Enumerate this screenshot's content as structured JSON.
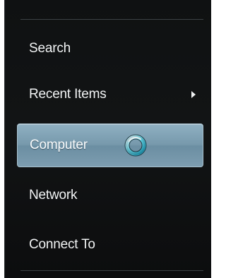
{
  "menu": {
    "items": [
      {
        "label": "Search",
        "has_submenu": false,
        "selected": false
      },
      {
        "label": "Recent Items",
        "has_submenu": true,
        "selected": false
      },
      {
        "label": "Computer",
        "has_submenu": false,
        "selected": true
      },
      {
        "label": "Network",
        "has_submenu": false,
        "selected": false
      },
      {
        "label": "Connect To",
        "has_submenu": false,
        "selected": false
      }
    ]
  },
  "cursor": {
    "icon": "busy-spinner-icon"
  },
  "colors": {
    "menu_background": "#111314",
    "selected_highlight": "#7d9db0",
    "text": "#f2f4f5",
    "spinner": "#3fd0e6"
  }
}
